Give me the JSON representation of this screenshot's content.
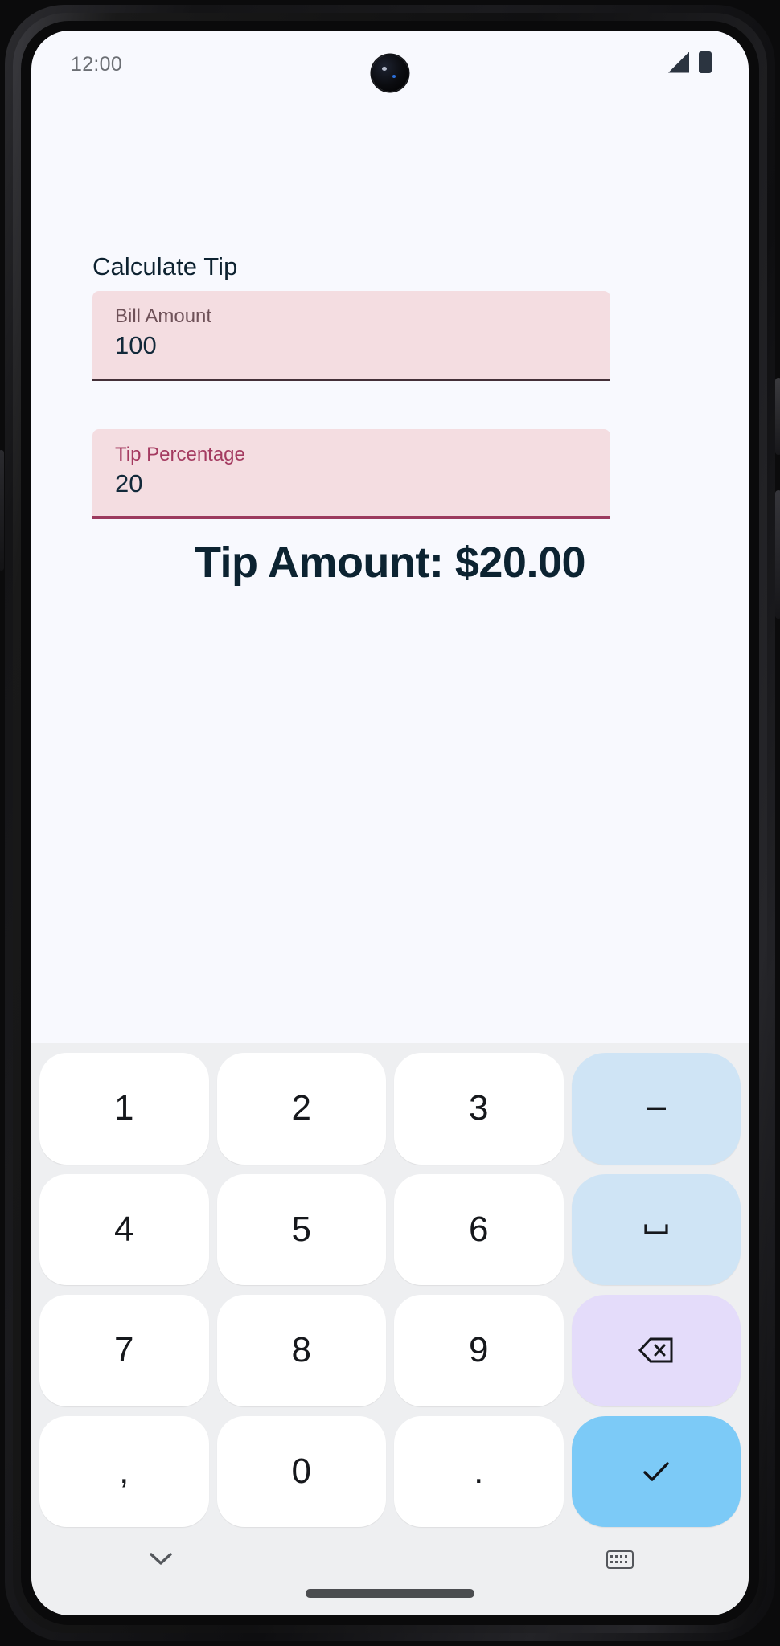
{
  "device": {
    "status_bar": {
      "time": "12:00",
      "signal_icon": "signal-icon",
      "battery_icon": "battery-icon",
      "camera_icon": "front-camera-punch-hole"
    },
    "navigation": {
      "hide_keyboard_icon": "chevron-down-icon",
      "switch_keyboard_icon": "keyboard-icon",
      "home_indicator": "home-indicator"
    }
  },
  "app": {
    "title": "Calculate Tip",
    "fields": [
      {
        "name": "bill-amount",
        "label": "Bill Amount",
        "value": "100",
        "placeholder": "Bill Amount",
        "focused": false
      },
      {
        "name": "tip-percentage",
        "label": "Tip Percentage",
        "value": "20",
        "placeholder": "Tip Percentage",
        "focused": true
      }
    ],
    "result": "Tip Amount: $20.00"
  },
  "keyboard": {
    "keys": [
      {
        "name": "key-1",
        "label": "1",
        "type": "digit"
      },
      {
        "name": "key-2",
        "label": "2",
        "type": "digit"
      },
      {
        "name": "key-3",
        "label": "3",
        "type": "digit"
      },
      {
        "name": "key-minus",
        "label": "−",
        "type": "minus"
      },
      {
        "name": "key-4",
        "label": "4",
        "type": "digit"
      },
      {
        "name": "key-5",
        "label": "5",
        "type": "digit"
      },
      {
        "name": "key-6",
        "label": "6",
        "type": "digit"
      },
      {
        "name": "key-space",
        "label": "␣",
        "type": "space"
      },
      {
        "name": "key-7",
        "label": "7",
        "type": "digit"
      },
      {
        "name": "key-8",
        "label": "8",
        "type": "digit"
      },
      {
        "name": "key-9",
        "label": "9",
        "type": "digit"
      },
      {
        "name": "key-backspace",
        "label": "",
        "type": "backspace"
      },
      {
        "name": "key-comma",
        "label": ",",
        "type": "punct"
      },
      {
        "name": "key-0",
        "label": "0",
        "type": "digit"
      },
      {
        "name": "key-period",
        "label": ".",
        "type": "punct"
      },
      {
        "name": "key-enter",
        "label": "",
        "type": "enter"
      }
    ]
  },
  "colors": {
    "screen_background": "#f8f9fe",
    "field_background": "#f4dde1",
    "field_label_unfocused": "#6e5158",
    "field_label_focused": "#a43a60",
    "field_underline_focused": "#9c3a5e",
    "text_primary": "#0c2331",
    "keyboard_background": "#eeeff1",
    "key_background": "#ffffff",
    "key_minus": "#cfe4f5",
    "key_space": "#cfe4f5",
    "key_backspace": "#e4dcfa",
    "key_enter": "#7ccaf7"
  }
}
